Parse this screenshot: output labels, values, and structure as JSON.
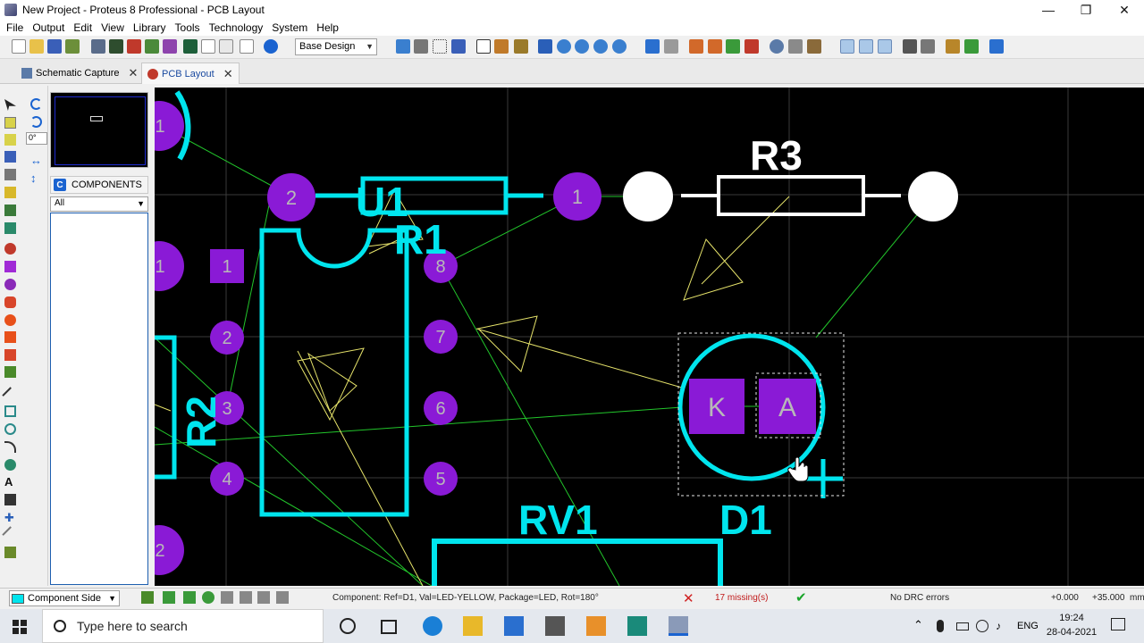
{
  "window": {
    "title": "New Project - Proteus 8 Professional - PCB Layout"
  },
  "menu": [
    "File",
    "Output",
    "Edit",
    "View",
    "Library",
    "Tools",
    "Technology",
    "System",
    "Help"
  ],
  "toolbar": {
    "design_layer": "Base Design"
  },
  "tabs": [
    {
      "label": "Schematic Capture",
      "active": false
    },
    {
      "label": "PCB Layout",
      "active": true
    }
  ],
  "left_tools": {
    "rotation_value": "0°"
  },
  "components_panel": {
    "title": "COMPONENTS",
    "title_icon_letter": "C",
    "filter_value": "All"
  },
  "pcb": {
    "colors": {
      "silkscreen": "#00e5ee",
      "pad": "#8a1ad6",
      "pad_label": "#b8b8b8",
      "ratsnest": "#22c52b",
      "force_vector": "#e6e36a",
      "ghost": "#ffffff"
    },
    "labels": {
      "r3": "R3",
      "r1": "R1",
      "u1": "U1",
      "r2": "R2",
      "rv1": "RV1",
      "d1": "D1",
      "plus": "+"
    },
    "ic_pins": [
      "1",
      "2",
      "3",
      "4",
      "5",
      "6",
      "7",
      "8"
    ],
    "pad_labels": {
      "edge_top": "1",
      "edge_mid": "1",
      "edge_bottom": "2",
      "r1_left": "2",
      "r1_right": "1"
    },
    "led_pads": [
      "K",
      "A"
    ]
  },
  "status": {
    "layer_select": "Component Side",
    "message": "Component:  Ref=D1, Val=LED-YELLOW, Package=LED, Rot=180°",
    "missing": "17 missing(s)",
    "drc": "No DRC errors",
    "x_coord": "+0.000",
    "y_coord": "+35.000",
    "unit": "mm"
  },
  "taskbar": {
    "search_placeholder": "Type here to search",
    "language": "ENG",
    "time": "19:24",
    "date": "28-04-2021"
  }
}
